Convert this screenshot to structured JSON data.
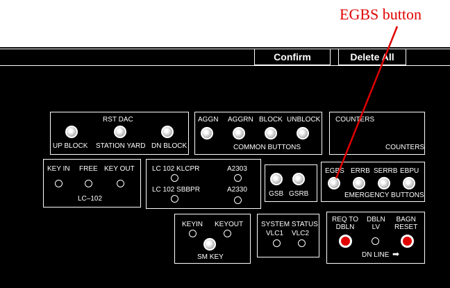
{
  "annotation": {
    "label": "EGBS button",
    "color": "#e00000"
  },
  "toolbar": {
    "confirm_label": "Confirm",
    "delete_all_label": "Delete All"
  },
  "rst_dac": {
    "title": "RST DAC",
    "up_block": "UP BLOCK",
    "station_yard": "STATION YARD",
    "dn_block": "DN BLOCK"
  },
  "common": {
    "aggn": "AGGN",
    "aggrn": "AGGRN",
    "block": "BLOCK",
    "unblock": "UNBLOCK",
    "caption": "COMMON BUTTONS"
  },
  "counters": {
    "title": "COUNTERS",
    "bottom_label": "COUNTERS"
  },
  "lc102": {
    "key_in": "KEY IN",
    "free": "FREE",
    "key_out": "KEY OUT",
    "caption": "LC–102"
  },
  "lc102_status": {
    "klcpr": "LC 102 KLCPR",
    "a2303": "A2303",
    "sbbpr": "LC 102 SBBPR",
    "a2330": "A2330"
  },
  "gsb": {
    "gsb": "GSB",
    "gsrb": "GSRB"
  },
  "emergency": {
    "egbs": "EGBS",
    "errb": "ERRB",
    "serrb": "SERRB",
    "ebpu": "EBPU",
    "caption": "EMERGENCY BUTTONS"
  },
  "sm_key": {
    "keyin": "KEYIN",
    "keyout": "KEYOUT",
    "caption": "SM KEY"
  },
  "system_status": {
    "title": "SYSTEM STATUS",
    "vlc1": "VLC1",
    "vlc2": "VLC2"
  },
  "dn_line": {
    "req_to_dbln": "REQ TO\nDBLN",
    "dbln_lv": "DBLN\nLV",
    "bagn_reset": "BAGN\nRESET",
    "caption": "DN LINE",
    "button_color": "#e00000"
  }
}
